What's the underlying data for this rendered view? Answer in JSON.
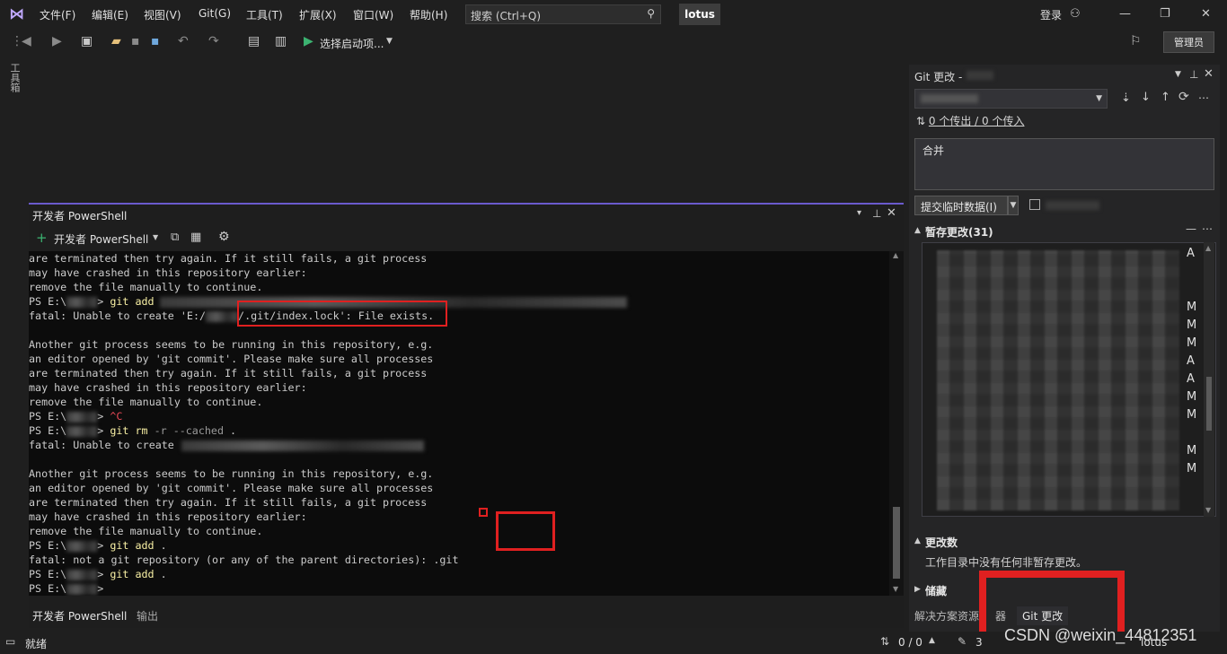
{
  "menubar": {
    "items": [
      "文件(F)",
      "编辑(E)",
      "视图(V)",
      "Git(G)",
      "工具(T)",
      "扩展(X)",
      "窗口(W)",
      "帮助(H)"
    ],
    "search_placeholder": "搜索 (Ctrl+Q)",
    "solution": "lotus",
    "login": "登录"
  },
  "toolbar": {
    "start_label": "选择启动项...",
    "admin": "管理员"
  },
  "toolbox_tab": "工具箱",
  "powershell": {
    "title": "开发者 PowerShell",
    "new_label": "开发者 PowerShell",
    "tabs": [
      "开发者 PowerShell",
      "输出"
    ],
    "lines": [
      {
        "t": "are terminated then try again. If it still fails, a git process"
      },
      {
        "t": "may have crashed in this repository earlier:"
      },
      {
        "t": "remove the file manually to continue."
      },
      {
        "p": "PS E:\\",
        "c": "git add"
      },
      {
        "t": "fatal: Unable to create 'E:/",
        "s": "/.git/index.lock': File exists."
      },
      {
        "t": ""
      },
      {
        "t": "Another git process seems to be running in this repository, e.g."
      },
      {
        "t": "an editor opened by 'git commit'. Please make sure all processes"
      },
      {
        "t": "are terminated then try again. If it still fails, a git process"
      },
      {
        "t": "may have crashed in this repository earlier:"
      },
      {
        "t": "remove the file manually to continue."
      },
      {
        "p": "PS E:\\",
        "x": "^C"
      },
      {
        "p": "PS E:\\",
        "c": "git rm",
        "a": "-r --cached",
        "e": " ."
      },
      {
        "t": "fatal: Unable to create"
      },
      {
        "t": ""
      },
      {
        "t": "Another git process seems to be running in this repository, e.g."
      },
      {
        "t": "an editor opened by 'git commit'. Please make sure all processes"
      },
      {
        "t": "are terminated then try again. If it still fails, a git process"
      },
      {
        "t": "may have crashed in this repository earlier:"
      },
      {
        "t": "remove the file manually to continue."
      },
      {
        "p": "PS E:\\",
        "c": "git add",
        "e": " ."
      },
      {
        "t": "fatal: not a git repository (or any of the parent directories): .git"
      },
      {
        "p": "PS E:\\",
        "c": "git add",
        "e": " ."
      },
      {
        "p": "PS E:\\",
        "e": ">"
      }
    ]
  },
  "git": {
    "title": "Git 更改 -",
    "sync": "0 个传出 / 0 个传入",
    "message": "合并",
    "commit_button": "提交临时数据(I)",
    "staged_header": "暂存更改(31)",
    "flags": [
      "A",
      "M",
      "M",
      "M",
      "A",
      "A",
      "M",
      "M",
      "M",
      "M"
    ],
    "changes_header": "更改数",
    "changes_empty": "工作目录中没有任何非暂存更改。",
    "stash_header": "储藏",
    "bottom_tabs": [
      "解决方案资源",
      "器",
      "Git 更改"
    ]
  },
  "status": {
    "ready": "就绪",
    "sync": "0 / 0",
    "count": "3",
    "branch": "lotus",
    "watermark": "CSDN @weixin_44812351"
  },
  "colors": {
    "accent": "#6a5acd",
    "highlight_red": "#e02020",
    "command_yellow": "#f9f1a5"
  }
}
